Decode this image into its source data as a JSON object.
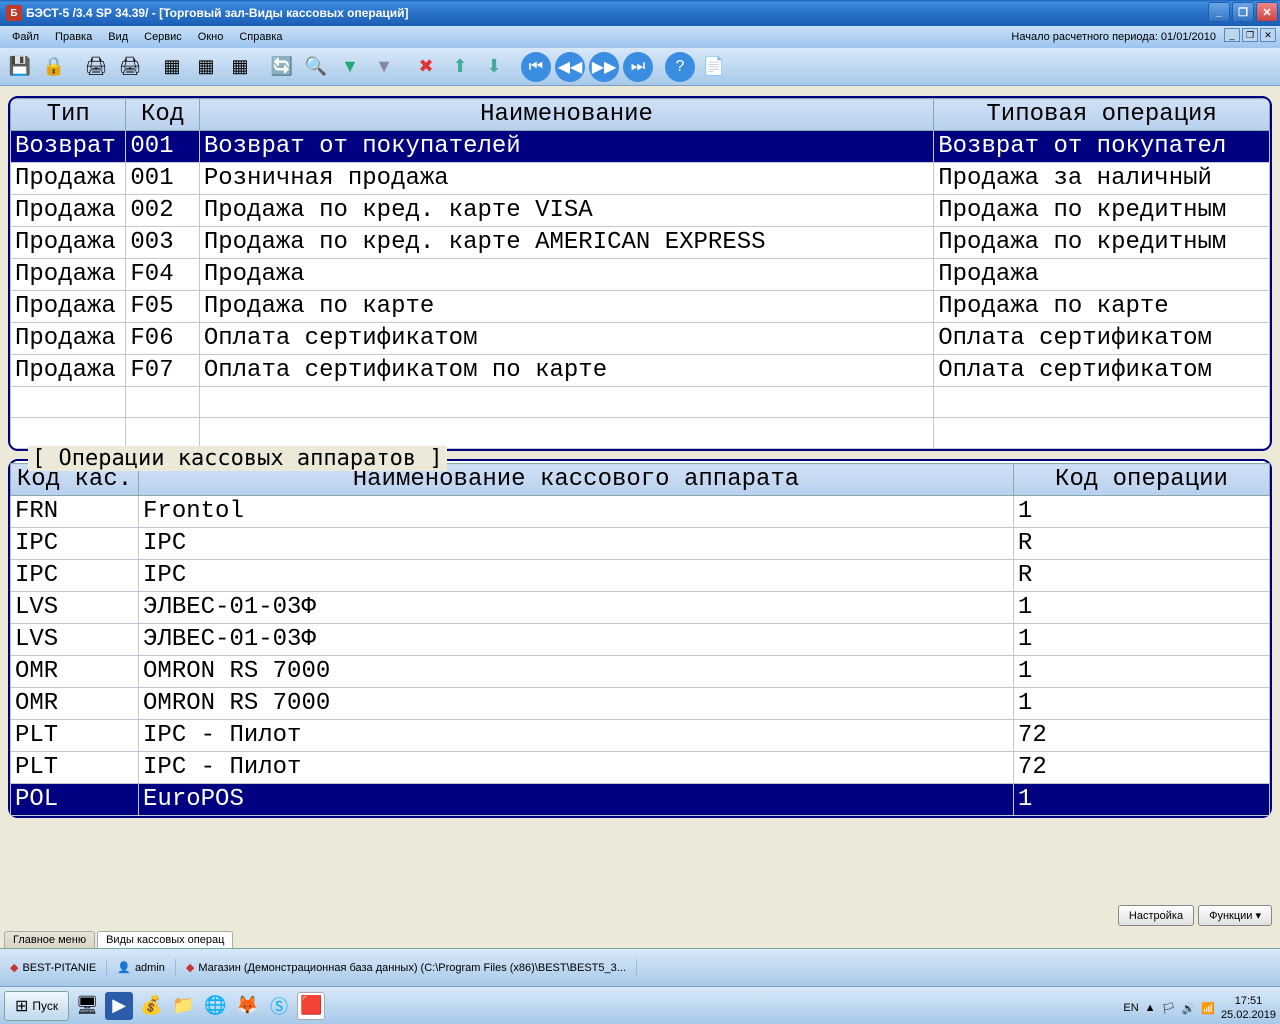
{
  "window": {
    "title": "БЭСТ-5 /3.4 SP 34.39/ - [Торговый зал-Виды кассовых операций]",
    "period_label": "Начало расчетного периода: 01/01/2010"
  },
  "menu": [
    "Файл",
    "Правка",
    "Вид",
    "Сервис",
    "Окно",
    "Справка"
  ],
  "grid1": {
    "headers": [
      "Тип",
      "Код",
      "Наименование",
      "Типовая операция"
    ],
    "rows": [
      {
        "type": "Возврат",
        "code": "001",
        "name": "Возврат от покупателей",
        "op": "Возврат от покупател",
        "sel": true
      },
      {
        "type": "Продажа",
        "code": "001",
        "name": "Розничная продажа",
        "op": "Продажа за наличный"
      },
      {
        "type": "Продажа",
        "code": "002",
        "name": "Продажа по кред. карте VISA",
        "op": "Продажа по кредитным"
      },
      {
        "type": "Продажа",
        "code": "003",
        "name": "Продажа по кред. карте AMERICAN EXPRESS",
        "op": "Продажа по кредитным"
      },
      {
        "type": "Продажа",
        "code": "F04",
        "name": "Продажа",
        "op": "Продажа"
      },
      {
        "type": "Продажа",
        "code": "F05",
        "name": "Продажа по карте",
        "op": "Продажа по карте"
      },
      {
        "type": "Продажа",
        "code": "F06",
        "name": "Оплата сертификатом",
        "op": "Оплата сертификатом"
      },
      {
        "type": "Продажа",
        "code": "F07",
        "name": "Оплата сертификатом по карте",
        "op": "Оплата сертификатом"
      }
    ]
  },
  "panel2": {
    "title": "[ Операции кассовых аппаратов ]",
    "headers": [
      "Код кас.",
      "Наименование кассового аппарата",
      "Код операции"
    ],
    "rows": [
      {
        "code": "FRN",
        "name": "Frontol",
        "op": "1"
      },
      {
        "code": "IPC",
        "name": "IPC",
        "op": "R"
      },
      {
        "code": "IPC",
        "name": "IPC",
        "op": "R"
      },
      {
        "code": "LVS",
        "name": "ЭЛВЕС-01-03Ф",
        "op": "1"
      },
      {
        "code": "LVS",
        "name": "ЭЛВЕС-01-03Ф",
        "op": "1"
      },
      {
        "code": "OMR",
        "name": "OMRON RS 7000",
        "op": "1"
      },
      {
        "code": "OMR",
        "name": "OMRON RS 7000",
        "op": "1"
      },
      {
        "code": "PLT",
        "name": "IPC - Пилот",
        "op": "72"
      },
      {
        "code": "PLT",
        "name": "IPC - Пилот",
        "op": "72"
      },
      {
        "code": "POL",
        "name": "EuroPOS",
        "op": "1",
        "sel": true
      }
    ]
  },
  "buttons": {
    "settings": "Настройка",
    "functions": "Функции"
  },
  "tabs": {
    "main": "Главное меню",
    "current": "Виды кассовых операц"
  },
  "status": {
    "db": "BEST-PITANIE",
    "user": "admin",
    "path": "Магазин (Демонстрационная база данных) (C:\\Program Files (x86)\\BEST\\BEST5_3..."
  },
  "taskbar": {
    "start": "Пуск",
    "lang": "EN",
    "time": "17:51",
    "date": "25.02.2019"
  },
  "colors": {
    "primary": "#000080",
    "header": "#b8d0ee"
  }
}
